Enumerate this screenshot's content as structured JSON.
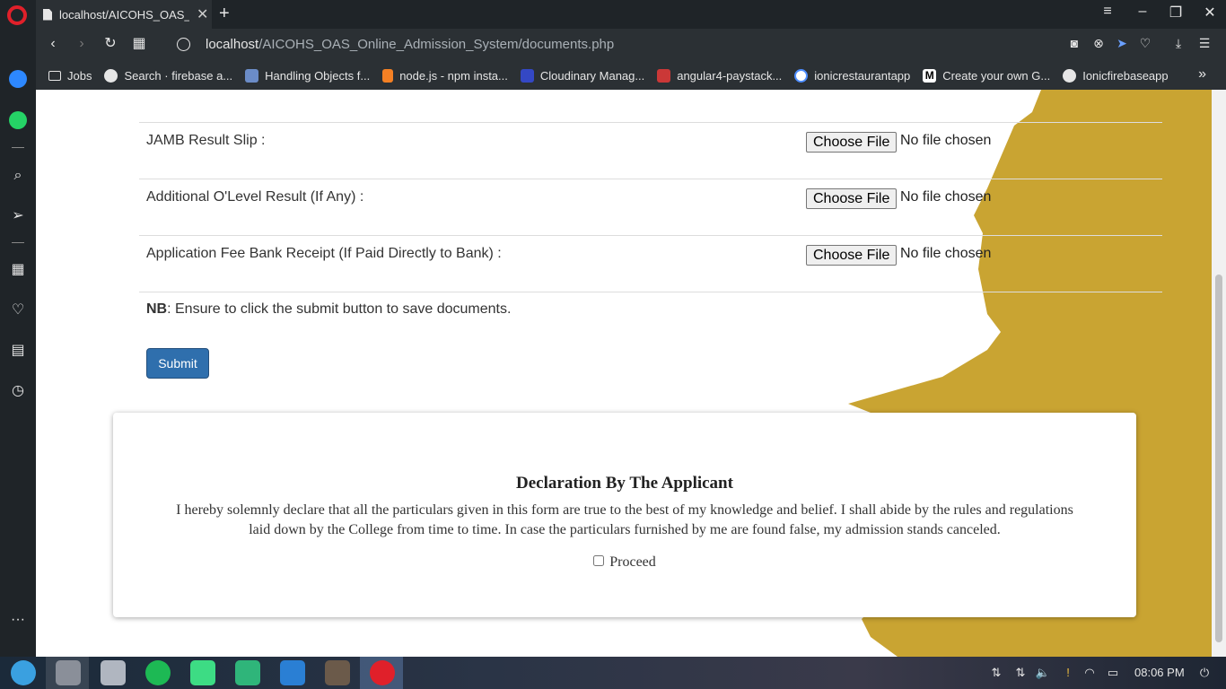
{
  "browser": {
    "tab_title": "localhost/AICOHS_OAS_Or",
    "url_host": "localhost",
    "url_path": "/AICOHS_OAS_Online_Admission_System/documents.php",
    "bookmarks": [
      {
        "label": "Jobs",
        "icon": "folder-icon",
        "color": "#e6e6e6"
      },
      {
        "label": "Search · firebase a...",
        "icon": "github-icon",
        "color": "#e6e6e6"
      },
      {
        "label": "Handling Objects f...",
        "icon": "avatar-icon",
        "color": "#6b8cc7"
      },
      {
        "label": "node.js - npm insta...",
        "icon": "stackoverflow-icon",
        "color": "#f48024"
      },
      {
        "label": "Cloudinary Manag...",
        "icon": "cloudinary-icon",
        "color": "#3448c5"
      },
      {
        "label": "angular4-paystack...",
        "icon": "npm-icon",
        "color": "#cb3837"
      },
      {
        "label": "ionicrestaurantapp",
        "icon": "ionic-icon",
        "color": "#4d8dff"
      },
      {
        "label": "Create your own G...",
        "icon": "medium-icon",
        "color": "#ffffff"
      },
      {
        "label": "Ionicfirebaseapp",
        "icon": "github-icon",
        "color": "#e6e6e6"
      }
    ]
  },
  "documents": [
    {
      "label": "JAMB Result Slip :",
      "button": "Choose File",
      "status": "No file chosen"
    },
    {
      "label": "Additional O'Level Result (If Any) :",
      "button": "Choose File",
      "status": "No file chosen"
    },
    {
      "label": "Application Fee Bank Receipt (If Paid Directly to Bank) :",
      "button": "Choose File",
      "status": "No file chosen"
    }
  ],
  "nb": {
    "bold": "NB",
    "text": ": Ensure to click the submit button to save documents."
  },
  "submit_label": "Submit",
  "declaration": {
    "title": "Declaration By The Applicant",
    "body": "I hereby solemnly declare that all the particulars given in this form are true to the best of my knowledge and belief. I shall abide by the rules and regulations laid down by the College from time to time. In case the particulars furnished by me are found false, my admission stands canceled.",
    "checkbox_label": "Proceed"
  },
  "taskbar": {
    "clock": "08:06 PM"
  },
  "colors": {
    "gold": "#c9a432",
    "submit_blue": "#2f6fad"
  }
}
